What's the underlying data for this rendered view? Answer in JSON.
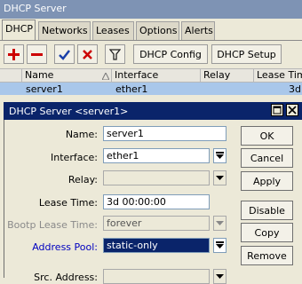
{
  "window": {
    "title": "DHCP Server"
  },
  "tabs": [
    {
      "label": "DHCP"
    },
    {
      "label": "Networks"
    },
    {
      "label": "Leases"
    },
    {
      "label": "Options"
    },
    {
      "label": "Alerts"
    }
  ],
  "toolbar": {
    "dhcp_config_label": "DHCP Config",
    "dhcp_setup_label": "DHCP Setup"
  },
  "table": {
    "columns": [
      "Name",
      "Interface",
      "Relay",
      "Lease Tim"
    ],
    "rows": [
      {
        "name": "server1",
        "interface": "ether1",
        "relay": "",
        "lease": "3d"
      }
    ]
  },
  "dialog": {
    "title": "DHCP Server <server1>",
    "fields": {
      "name": {
        "label": "Name:",
        "value": "server1"
      },
      "interface": {
        "label": "Interface:",
        "value": "ether1"
      },
      "relay": {
        "label": "Relay:",
        "value": ""
      },
      "lease_time": {
        "label": "Lease Time:",
        "value": "3d 00:00:00"
      },
      "bootp_lease_time": {
        "label": "Bootp Lease Time:",
        "value": "forever"
      },
      "address_pool": {
        "label": "Address Pool:",
        "value": "static-only"
      },
      "src_address": {
        "label": "Src. Address:",
        "value": ""
      }
    },
    "buttons": {
      "ok": "OK",
      "cancel": "Cancel",
      "apply": "Apply",
      "disable": "Disable",
      "copy": "Copy",
      "remove": "Remove"
    }
  },
  "colors": {
    "title_bar": "#7e93b4",
    "dialog_title_bar": "#0a246a",
    "selected_row": "#a9c7ea",
    "add_icon": "#cc0000",
    "remove_icon": "#cc0000",
    "enable_icon": "#1a3fa8",
    "disable_icon": "#cc0000"
  }
}
